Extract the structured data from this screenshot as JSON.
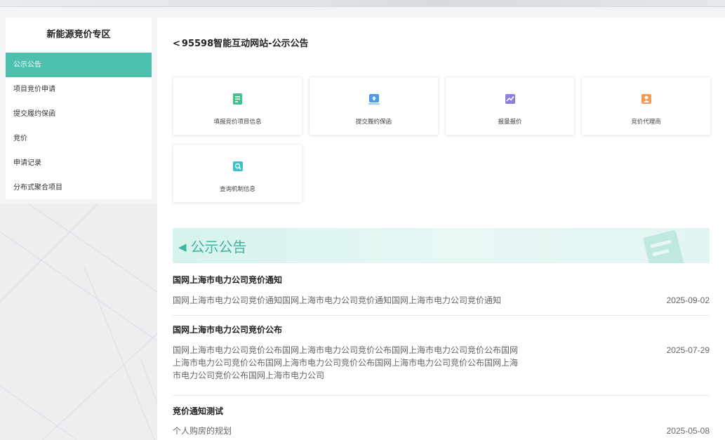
{
  "sidebar": {
    "title": "新能源竞价专区",
    "items": [
      {
        "label": "公示公告",
        "active": true
      },
      {
        "label": "项目竞价申请"
      },
      {
        "label": "提交履约保函"
      },
      {
        "label": "竞价"
      },
      {
        "label": "申请记录"
      },
      {
        "label": "分布式聚合项目"
      }
    ]
  },
  "header": {
    "back_glyph": "<",
    "title": "95598智能互动网站-公示公告"
  },
  "cards": [
    {
      "label": "填报竞价项目信息",
      "icon": "form-icon",
      "color": "#45c08c"
    },
    {
      "label": "提交履约保函",
      "icon": "upload-icon",
      "color": "#4b9bea"
    },
    {
      "label": "报量报价",
      "icon": "chart-icon",
      "color": "#8e7fe0"
    },
    {
      "label": "竞价代理商",
      "icon": "agent-icon",
      "color": "#f39a55"
    },
    {
      "label": "查询机制信息",
      "icon": "query-icon",
      "color": "#3cbfc8"
    }
  ],
  "banner": {
    "title": "公示公告",
    "icon": "speaker-icon",
    "accent": "#3fb3a0"
  },
  "notices": [
    {
      "title": "国网上海市电力公司竞价通知",
      "body": "国网上海市电力公司竞价通知国网上海市电力公司竞价通知国网上海市电力公司竞价通知",
      "date": "2025-09-02"
    },
    {
      "title": "国网上海市电力公司竞价公布",
      "body_lines": [
        "国网上海市电力公司竞价公布国网上海市电力公司竞价公布国网上海市电力公司竞价公布国网",
        "上海市电力公司竞价公布国网上海市电力公司竞价公布国网上海市电力公司竞价公布国网上海",
        "市电力公司竞价公布国网上海市电力公司"
      ],
      "date": "2025-07-29"
    },
    {
      "title": "竞价通知测试",
      "body": "个人购房的规划",
      "date": "2025-05-08"
    }
  ]
}
